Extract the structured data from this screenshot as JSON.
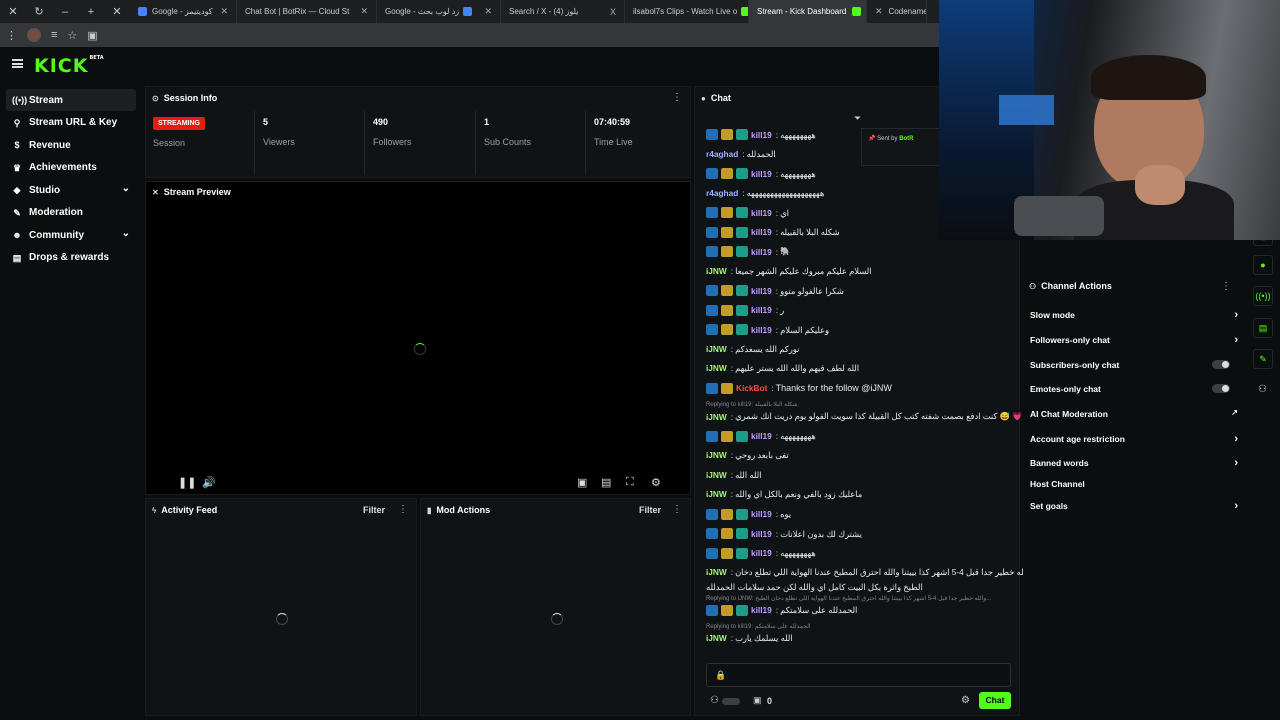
{
  "browser": {
    "tabs": [
      {
        "title": "Google - كوديتيمز",
        "color": "#4285f4"
      },
      {
        "title": "Chat Bot | BotRix — Cloud St",
        "color": "#9aa0a6"
      },
      {
        "title": "Google - زد لوب بحث",
        "color": "#4285f4"
      },
      {
        "title": "Search / X - (4) يلوز",
        "color": "#e6e8ea"
      },
      {
        "title": "ilsabol7s Clips - Watch Live o",
        "color": "#53fc18"
      },
      {
        "title": "Stream - Kick Dashboard",
        "color": "#53fc18"
      },
      {
        "title": "Codenames -",
        "color": "#53fc18"
      }
    ]
  },
  "brand": {
    "name": "KICK",
    "tag": "BETA",
    "accent": "#53fc18"
  },
  "sidebar": {
    "items": [
      {
        "label": "Stream",
        "icon": "broadcast-icon",
        "active": true
      },
      {
        "label": "Stream URL & Key",
        "icon": "link-icon"
      },
      {
        "label": "Revenue",
        "icon": "dollar-icon"
      },
      {
        "label": "Achievements",
        "icon": "trophy-icon"
      },
      {
        "label": "Studio",
        "icon": "studio-icon",
        "expandable": true
      },
      {
        "label": "Moderation",
        "icon": "wrench-icon"
      },
      {
        "label": "Community",
        "icon": "people-icon",
        "expandable": true
      },
      {
        "label": "Drops & rewards",
        "icon": "gift-icon"
      }
    ]
  },
  "session": {
    "title": "Session Info",
    "status": "STREAMING",
    "session_label": "Session",
    "stats": [
      {
        "value": "5",
        "label": "Viewers"
      },
      {
        "value": "490",
        "label": "Followers"
      },
      {
        "value": "1",
        "label": "Sub Counts"
      },
      {
        "value": "07:40:59",
        "label": "Time Live"
      }
    ]
  },
  "preview": {
    "title": "Stream Preview"
  },
  "activity": {
    "title": "Activity Feed",
    "filter": "Filter"
  },
  "mod": {
    "title": "Mod Actions",
    "filter": "Filter"
  },
  "chat": {
    "title": "Chat",
    "sent_by": "Sent by",
    "sent_by_name": "BotR",
    "messages": [
      {
        "user": "kill19",
        "color": "#c39bff",
        "text": "ههههههههه",
        "badges": 3
      },
      {
        "user": "r4aghad",
        "color": "#9fb2ff",
        "text": "الحمدلله",
        "badges": 0
      },
      {
        "user": "kill19",
        "color": "#c39bff",
        "text": "ههههههههه",
        "badges": 3
      },
      {
        "user": "r4aghad",
        "color": "#9fb2ff",
        "text": "هههههههههههههههههههه",
        "badges": 0
      },
      {
        "user": "kill19",
        "color": "#c39bff",
        "text": "اي",
        "badges": 3
      },
      {
        "user": "kill19",
        "color": "#c39bff",
        "text": "شكله البلا بالقبيله",
        "badges": 3
      },
      {
        "user": "kill19",
        "color": "#c39bff",
        "text": "🐘",
        "badges": 3
      },
      {
        "user": "iJNW",
        "color": "#a8f07a",
        "text": "السلام عليكم مبروك عليكم الشهر جميعا",
        "badges": 0
      },
      {
        "user": "kill19",
        "color": "#c39bff",
        "text": "شكرا عالفولو متوو",
        "badges": 3
      },
      {
        "user": "kill19",
        "color": "#c39bff",
        "text": "ر",
        "badges": 3
      },
      {
        "user": "kill19",
        "color": "#c39bff",
        "text": "وعليكم السلام",
        "badges": 3
      },
      {
        "user": "iJNW",
        "color": "#a8f07a",
        "text": "نوركم الله يسعدكم",
        "badges": 0
      },
      {
        "user": "iJNW",
        "color": "#a8f07a",
        "text": "الله لطف فيهم والله الله يستر عليهم",
        "badges": 0
      },
      {
        "user": "KickBot",
        "color": "#ff4a4a",
        "text": "Thanks for the follow @iJNW",
        "badges": 2
      },
      {
        "user": "iJNW",
        "color": "#a8f07a",
        "text": "كنت ادفع بصمت شفته كتب كل القبيلة كذا سويت الفولو يوم دريت انك شمري 😅 💗",
        "badges": 0,
        "reply": "Replying to kill19: شكله البلا بالقبيله"
      },
      {
        "user": "kill19",
        "color": "#c39bff",
        "text": "ههههههههه",
        "badges": 3
      },
      {
        "user": "iJNW",
        "color": "#a8f07a",
        "text": "تفى بابعد روحي",
        "badges": 0
      },
      {
        "user": "iJNW",
        "color": "#a8f07a",
        "text": "الله الله",
        "badges": 0
      },
      {
        "user": "iJNW",
        "color": "#a8f07a",
        "text": "ماعليك زود بالفي ونعم بالكل اي والله",
        "badges": 0
      },
      {
        "user": "kill19",
        "color": "#c39bff",
        "text": "يوه",
        "badges": 3
      },
      {
        "user": "kill19",
        "color": "#c39bff",
        "text": "يشترك لك بدون اعلانات",
        "badges": 3
      },
      {
        "user": "kill19",
        "color": "#c39bff",
        "text": "ههههههههه",
        "badges": 3
      },
      {
        "user": "iJNW",
        "color": "#a8f07a",
        "text": "والله خطير جدا قبل 4-5 اشهر كذا بييتنا والله احترق المطبخ عندنا الهواية اللي تطلع دخان",
        "text2": "الطبخ واثرة بكل البيت كامل اي والله لكن حمد سلامات الحمدلله",
        "badges": 0
      },
      {
        "user": "kill19",
        "color": "#c39bff",
        "text": "الحمدلله على سلامتكم",
        "badges": 3,
        "reply": "Replying to iJNW: والله خطير جدا قبل 4-5 اشهر كذا بييتنا والله احترق المطبخ عندنا الهواية اللي تطلع دخان الطبخ..."
      },
      {
        "user": "iJNW",
        "color": "#a8f07a",
        "text": "الله يسلمك يارب",
        "badges": 0,
        "reply": "Replying to kill19: الحمدلله على سلامتكم"
      }
    ],
    "points": "0",
    "send_label": "Chat"
  },
  "channel_actions": {
    "title": "Channel Actions",
    "items": [
      {
        "label": "Slow mode",
        "control": "arrow"
      },
      {
        "label": "Followers-only chat",
        "control": "arrow"
      },
      {
        "label": "Subscribers-only chat",
        "control": "toggle"
      },
      {
        "label": "Emotes-only chat",
        "control": "toggle"
      },
      {
        "label": "AI Chat Moderation",
        "control": "external"
      },
      {
        "label": "Account age restriction",
        "control": "arrow"
      },
      {
        "label": "Banned words",
        "control": "arrow"
      },
      {
        "label": "Host Channel",
        "control": "none"
      },
      {
        "label": "Set goals",
        "control": "arrow"
      }
    ]
  }
}
